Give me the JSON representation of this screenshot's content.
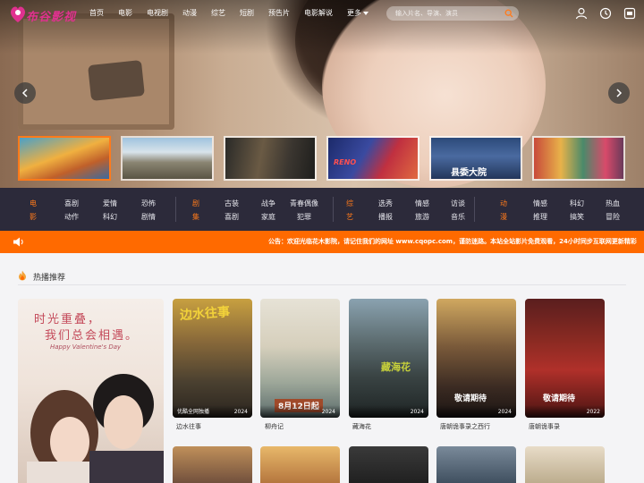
{
  "header": {
    "logo_text": "布谷影视",
    "nav": [
      "首页",
      "电影",
      "电视剧",
      "动漫",
      "综艺",
      "短剧",
      "预告片",
      "电影解说"
    ],
    "more_label": "更多",
    "search_placeholder": "输入片名、导演、演员"
  },
  "hero": {
    "thumbnails": [
      {
        "caption": ""
      },
      {
        "caption": ""
      },
      {
        "caption": ""
      },
      {
        "caption": "RENO"
      },
      {
        "caption": "县委大院"
      },
      {
        "caption": ""
      }
    ]
  },
  "categories": {
    "movie": {
      "title": "电影",
      "links": [
        "喜剧",
        "爱情",
        "恐怖",
        "动作",
        "科幻",
        "剧情"
      ]
    },
    "series": {
      "title": "剧集",
      "links": [
        "古装",
        "战争",
        "青春偶像",
        "喜剧",
        "家庭",
        "犯罪"
      ]
    },
    "variety": {
      "title": "综艺",
      "links": [
        "选秀",
        "情感",
        "访谈",
        "播报",
        "旅游",
        "音乐"
      ]
    },
    "anime": {
      "title": "动漫",
      "links": [
        "情感",
        "科幻",
        "热血",
        "推理",
        "搞笑",
        "冒险"
      ]
    }
  },
  "notice": {
    "text": "公告：欢迎光临花木影院，请记住我们的网址 www.cqopc.com，谨防迷路。本站全站影片免费观看，24小时同步互联网更新精彩"
  },
  "section": {
    "title": "热播推荐"
  },
  "big_card": {
    "line1": "时光重叠，",
    "line2": "我们总会相遇。",
    "line3": "Happy Valentine's Day"
  },
  "cards": [
    {
      "title": "边水往事",
      "badge": "优酷全网独播",
      "year": "2024",
      "poster_text": "边水往事"
    },
    {
      "title": "柳舟记",
      "badge": "",
      "year": "2024",
      "poster_text": "8月12日起"
    },
    {
      "title": "藏海花",
      "badge": "",
      "year": "2024",
      "poster_text": "藏海花"
    },
    {
      "title": "唐朝诡事录之西行",
      "badge": "",
      "year": "2024",
      "poster_text": "敬请期待"
    },
    {
      "title": "唐朝诡事录",
      "badge": "",
      "year": "2022",
      "poster_text": "敬请期待"
    }
  ],
  "colors": {
    "accent": "#ff6a00",
    "catbar": "#2c2a3a",
    "logo": "#e0318f"
  }
}
